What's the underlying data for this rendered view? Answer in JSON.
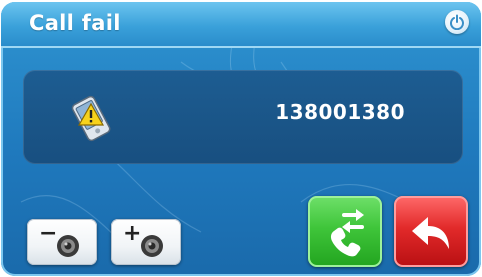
{
  "title": "Call fail",
  "phone_number": "138001380",
  "controls": {
    "volume_down_sign": "−",
    "volume_up_sign": "+"
  },
  "icons": {
    "power": "power-icon",
    "phone_warning": "phone-warning-icon",
    "speaker": "speaker-icon",
    "redial": "redial-icon",
    "back": "back-arrow-icon"
  },
  "colors": {
    "background": "#1f79bd",
    "panel": "#1b578a",
    "redial_green": "#3fc53a",
    "back_red": "#e22a2a"
  }
}
